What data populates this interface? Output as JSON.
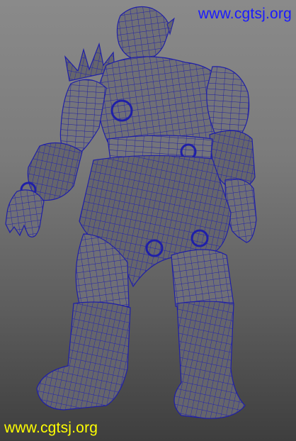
{
  "viewport": {
    "watermark_top": "www.cgtsj.org",
    "watermark_bottom": "www.cgtsj.org"
  },
  "colors": {
    "background_top": "#8a8a8a",
    "background_bottom": "#3e3e3e",
    "mesh_fill": "#6d6d74",
    "wire": "#1f1fa8",
    "watermark_top": "#1a1aff",
    "watermark_bottom": "#ffff00"
  },
  "model": {
    "icon": "orc-warrior-wireframe-mesh"
  }
}
